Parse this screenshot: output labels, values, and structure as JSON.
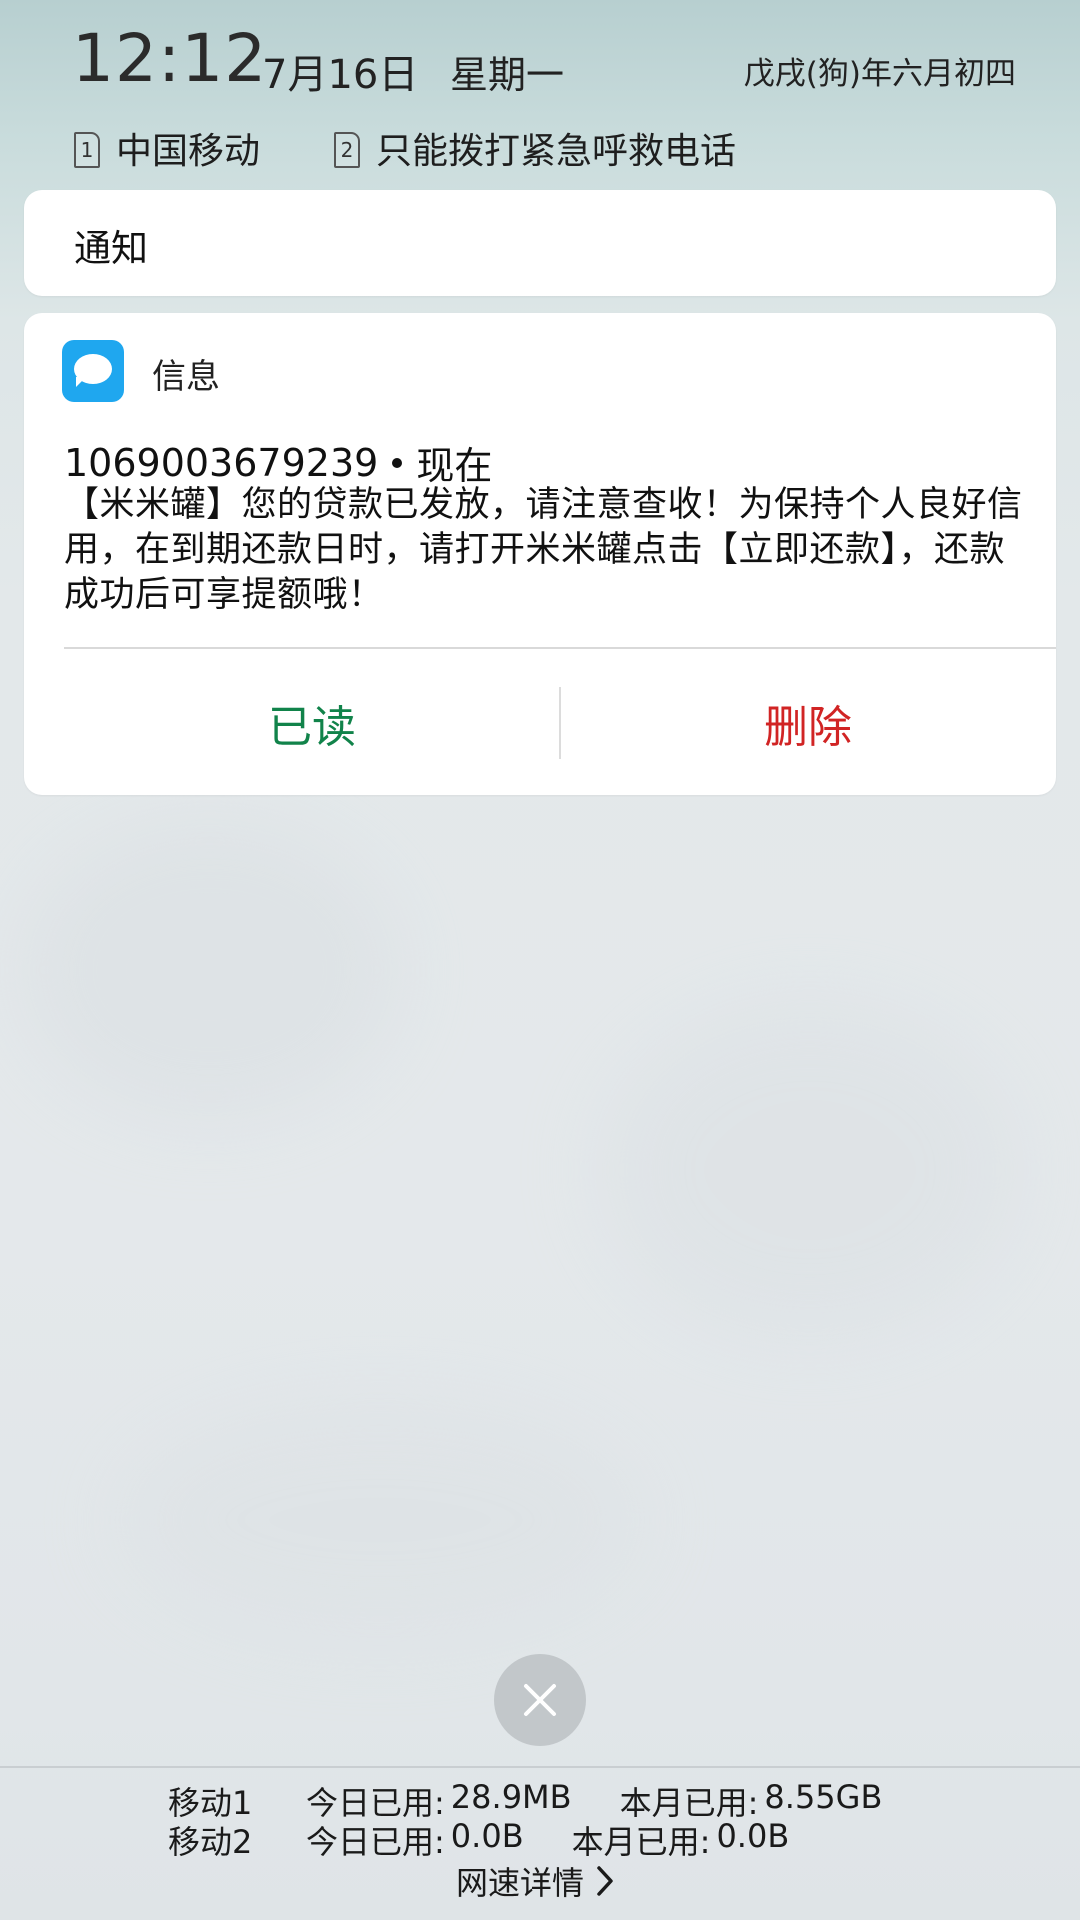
{
  "status": {
    "time": "12:12",
    "date": "7月16日",
    "weekday": "星期一",
    "lunar": "戊戌(狗)年六月初四",
    "sim1": {
      "index": "1",
      "label": "中国移动"
    },
    "sim2": {
      "index": "2",
      "label": "只能拨打紧急呼救电话"
    }
  },
  "notice_card": {
    "title": "通知"
  },
  "message_card": {
    "app_name": "信息",
    "app_icon": "message-bubble-icon",
    "sender": "1069003679239",
    "time_label": "现在",
    "body": "【米米罐】您的贷款已发放，请注意查收！为保持个人良好信用，在到期还款日时，请打开米米罐点击【立即还款】，还款成功后可享提额哦！",
    "actions": {
      "read": "已读",
      "delete": "删除"
    }
  },
  "close_icon": "close-icon",
  "data_usage": {
    "sim1": {
      "name": "移动1",
      "today_label": "今日已用:",
      "today_value": "28.9MB",
      "month_label": "本月已用:",
      "month_value": "8.55GB"
    },
    "sim2": {
      "name": "移动2",
      "today_label": "今日已用:",
      "today_value": "0.0B",
      "month_label": "本月已用:",
      "month_value": "0.0B"
    },
    "speed_details": "网速详情"
  },
  "colors": {
    "read_action": "#11834a",
    "delete_action": "#d12424",
    "app_icon": "#1fa7ef"
  }
}
